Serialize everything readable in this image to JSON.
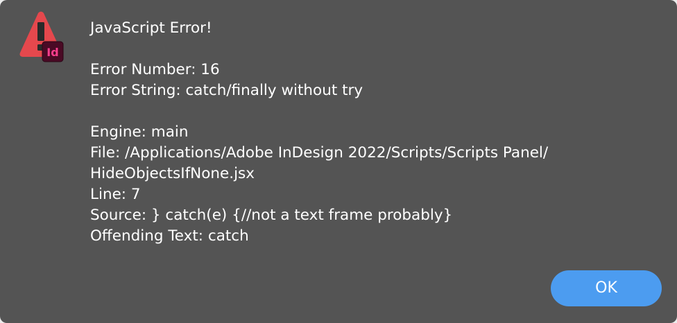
{
  "dialog": {
    "title": "JavaScript Error!",
    "error_number": "Error Number: 16",
    "error_string": "Error String: catch/finally without try",
    "engine": "Engine: main",
    "file_line_1": "File: /Applications/Adobe InDesign 2022/Scripts/Scripts Panel/",
    "file_line_2": "HideObjectsIfNone.jsx",
    "line": "Line: 7",
    "source": "Source: } catch(e) {//not a text frame probably}",
    "offending_text": "Offending Text: catch",
    "ok_label": "OK"
  },
  "icon": {
    "name": "indesign-warning-icon",
    "badge_text": "Id",
    "warning_color": "#e5484d",
    "badge_bg": "#4a0a25",
    "badge_fg": "#ff3f8e"
  },
  "colors": {
    "dialog_bg": "#545454",
    "button_bg": "#4c9cf0",
    "text": "#ffffff"
  }
}
